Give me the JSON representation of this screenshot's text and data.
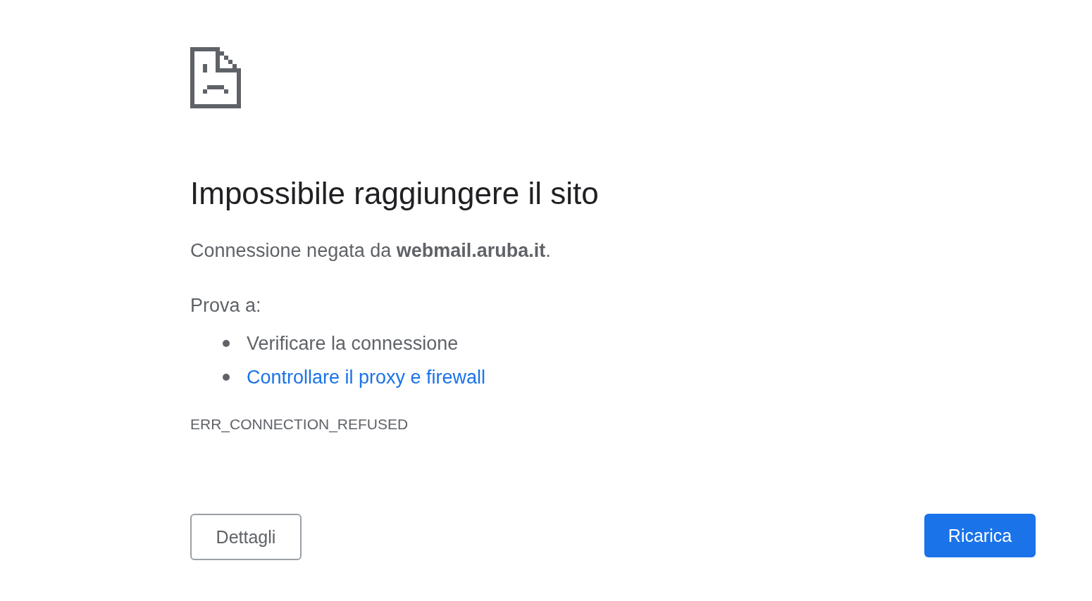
{
  "heading": "Impossibile raggiungere il sito",
  "message": "Connessione negata da **webmail.aruba.it**.",
  "suggestions_intro": "Prova a:",
  "suggestions": [
    {
      "text": "Verificare la connessione",
      "kind": "text"
    },
    {
      "text": "Controllare il proxy e firewall",
      "kind": "link"
    }
  ],
  "error_code": "ERR_CONNECTION_REFUSED",
  "buttons": [
    {
      "label": "Dettagli",
      "kind": "secondary"
    },
    {
      "label": "Ricarica",
      "kind": "primary"
    }
  ]
}
